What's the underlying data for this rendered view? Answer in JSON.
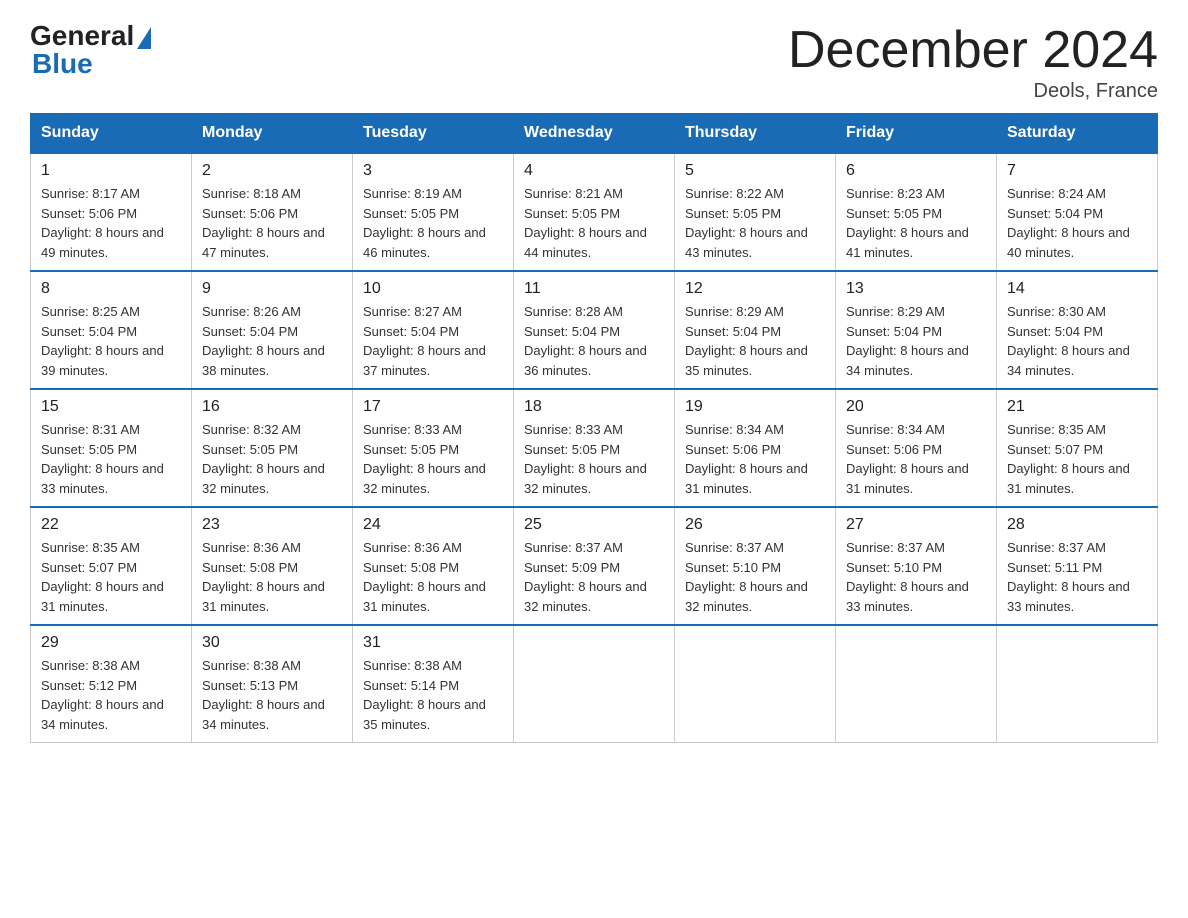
{
  "logo": {
    "general": "General",
    "blue": "Blue"
  },
  "title": "December 2024",
  "location": "Deols, France",
  "days_of_week": [
    "Sunday",
    "Monday",
    "Tuesday",
    "Wednesday",
    "Thursday",
    "Friday",
    "Saturday"
  ],
  "weeks": [
    [
      {
        "day": "1",
        "sunrise": "8:17 AM",
        "sunset": "5:06 PM",
        "daylight": "8 hours and 49 minutes."
      },
      {
        "day": "2",
        "sunrise": "8:18 AM",
        "sunset": "5:06 PM",
        "daylight": "8 hours and 47 minutes."
      },
      {
        "day": "3",
        "sunrise": "8:19 AM",
        "sunset": "5:05 PM",
        "daylight": "8 hours and 46 minutes."
      },
      {
        "day": "4",
        "sunrise": "8:21 AM",
        "sunset": "5:05 PM",
        "daylight": "8 hours and 44 minutes."
      },
      {
        "day": "5",
        "sunrise": "8:22 AM",
        "sunset": "5:05 PM",
        "daylight": "8 hours and 43 minutes."
      },
      {
        "day": "6",
        "sunrise": "8:23 AM",
        "sunset": "5:05 PM",
        "daylight": "8 hours and 41 minutes."
      },
      {
        "day": "7",
        "sunrise": "8:24 AM",
        "sunset": "5:04 PM",
        "daylight": "8 hours and 40 minutes."
      }
    ],
    [
      {
        "day": "8",
        "sunrise": "8:25 AM",
        "sunset": "5:04 PM",
        "daylight": "8 hours and 39 minutes."
      },
      {
        "day": "9",
        "sunrise": "8:26 AM",
        "sunset": "5:04 PM",
        "daylight": "8 hours and 38 minutes."
      },
      {
        "day": "10",
        "sunrise": "8:27 AM",
        "sunset": "5:04 PM",
        "daylight": "8 hours and 37 minutes."
      },
      {
        "day": "11",
        "sunrise": "8:28 AM",
        "sunset": "5:04 PM",
        "daylight": "8 hours and 36 minutes."
      },
      {
        "day": "12",
        "sunrise": "8:29 AM",
        "sunset": "5:04 PM",
        "daylight": "8 hours and 35 minutes."
      },
      {
        "day": "13",
        "sunrise": "8:29 AM",
        "sunset": "5:04 PM",
        "daylight": "8 hours and 34 minutes."
      },
      {
        "day": "14",
        "sunrise": "8:30 AM",
        "sunset": "5:04 PM",
        "daylight": "8 hours and 34 minutes."
      }
    ],
    [
      {
        "day": "15",
        "sunrise": "8:31 AM",
        "sunset": "5:05 PM",
        "daylight": "8 hours and 33 minutes."
      },
      {
        "day": "16",
        "sunrise": "8:32 AM",
        "sunset": "5:05 PM",
        "daylight": "8 hours and 32 minutes."
      },
      {
        "day": "17",
        "sunrise": "8:33 AM",
        "sunset": "5:05 PM",
        "daylight": "8 hours and 32 minutes."
      },
      {
        "day": "18",
        "sunrise": "8:33 AM",
        "sunset": "5:05 PM",
        "daylight": "8 hours and 32 minutes."
      },
      {
        "day": "19",
        "sunrise": "8:34 AM",
        "sunset": "5:06 PM",
        "daylight": "8 hours and 31 minutes."
      },
      {
        "day": "20",
        "sunrise": "8:34 AM",
        "sunset": "5:06 PM",
        "daylight": "8 hours and 31 minutes."
      },
      {
        "day": "21",
        "sunrise": "8:35 AM",
        "sunset": "5:07 PM",
        "daylight": "8 hours and 31 minutes."
      }
    ],
    [
      {
        "day": "22",
        "sunrise": "8:35 AM",
        "sunset": "5:07 PM",
        "daylight": "8 hours and 31 minutes."
      },
      {
        "day": "23",
        "sunrise": "8:36 AM",
        "sunset": "5:08 PM",
        "daylight": "8 hours and 31 minutes."
      },
      {
        "day": "24",
        "sunrise": "8:36 AM",
        "sunset": "5:08 PM",
        "daylight": "8 hours and 31 minutes."
      },
      {
        "day": "25",
        "sunrise": "8:37 AM",
        "sunset": "5:09 PM",
        "daylight": "8 hours and 32 minutes."
      },
      {
        "day": "26",
        "sunrise": "8:37 AM",
        "sunset": "5:10 PM",
        "daylight": "8 hours and 32 minutes."
      },
      {
        "day": "27",
        "sunrise": "8:37 AM",
        "sunset": "5:10 PM",
        "daylight": "8 hours and 33 minutes."
      },
      {
        "day": "28",
        "sunrise": "8:37 AM",
        "sunset": "5:11 PM",
        "daylight": "8 hours and 33 minutes."
      }
    ],
    [
      {
        "day": "29",
        "sunrise": "8:38 AM",
        "sunset": "5:12 PM",
        "daylight": "8 hours and 34 minutes."
      },
      {
        "day": "30",
        "sunrise": "8:38 AM",
        "sunset": "5:13 PM",
        "daylight": "8 hours and 34 minutes."
      },
      {
        "day": "31",
        "sunrise": "8:38 AM",
        "sunset": "5:14 PM",
        "daylight": "8 hours and 35 minutes."
      },
      null,
      null,
      null,
      null
    ]
  ]
}
